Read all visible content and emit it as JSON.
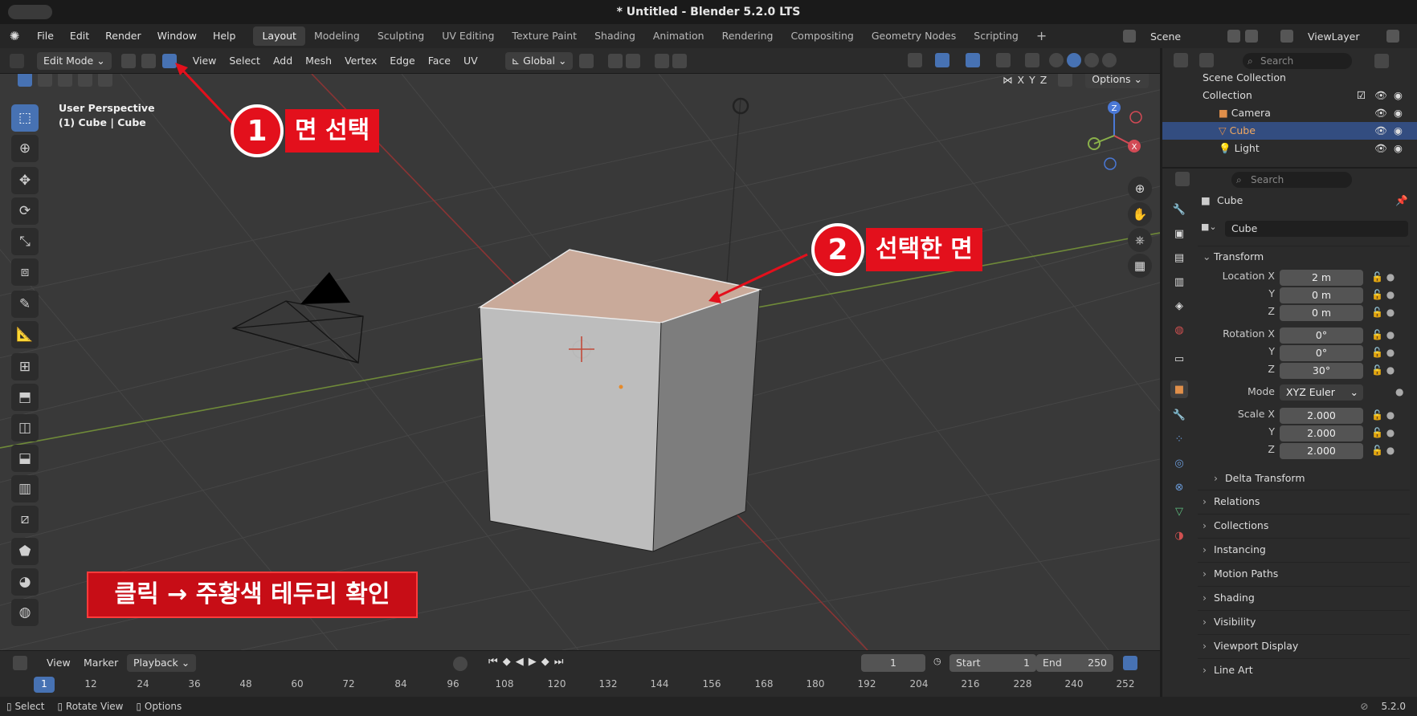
{
  "window": {
    "title": "* Untitled - Blender 5.2.0 LTS"
  },
  "menu": {
    "items": [
      "File",
      "Edit",
      "Render",
      "Window",
      "Help"
    ],
    "workspaces": [
      "Layout",
      "Modeling",
      "Sculpting",
      "UV Editing",
      "Texture Paint",
      "Shading",
      "Animation",
      "Rendering",
      "Compositing",
      "Geometry Nodes",
      "Scripting"
    ],
    "active_workspace": "Layout",
    "add_tab": "+",
    "scene": "Scene",
    "view_layer": "ViewLayer"
  },
  "viewport_header": {
    "mode": "Edit Mode",
    "menus": [
      "View",
      "Select",
      "Add",
      "Mesh",
      "Vertex",
      "Edge",
      "Face",
      "UV"
    ],
    "orientation": "Global",
    "axes": [
      "X",
      "Y",
      "Z"
    ],
    "options": "Options"
  },
  "viewport": {
    "perspective": "User Perspective",
    "object_info": "(1) Cube | Cube",
    "gizmo": {
      "z": "Z",
      "x": "X"
    }
  },
  "callouts": [
    {
      "number": "1",
      "text": "면 선택"
    },
    {
      "number": "2",
      "text": "선택한 면"
    }
  ],
  "note": "클릭 → 주황색 테두리 확인",
  "colors": {
    "accent": "#4772b3",
    "callout_red": "#e3101c",
    "selected_face": "#c9aa9a"
  },
  "outliner": {
    "search_placeholder": "Search",
    "scene_collection": "Scene Collection",
    "collection": "Collection",
    "items": [
      "Camera",
      "Cube",
      "Light"
    ],
    "selected": "Cube"
  },
  "properties": {
    "search_placeholder": "Search",
    "object_name": "Cube",
    "data_name": "Cube",
    "transform": {
      "title": "Transform",
      "location_label": "Location X",
      "rotation_label": "Rotation X",
      "scale_label": "Scale X",
      "y_label": "Y",
      "z_label": "Z",
      "location": [
        "2 m",
        "0 m",
        "0 m"
      ],
      "rotation": [
        "0°",
        "0°",
        "30°"
      ],
      "mode_label": "Mode",
      "mode": "XYZ Euler",
      "scale": [
        "2.000",
        "2.000",
        "2.000"
      ],
      "delta": "Delta Transform"
    },
    "sections": [
      "Relations",
      "Collections",
      "Instancing",
      "Motion Paths",
      "Shading",
      "Visibility",
      "Viewport Display",
      "Line Art"
    ]
  },
  "timeline": {
    "menus": [
      "View",
      "Marker",
      "Playback"
    ],
    "current_frame": "1",
    "start_label": "Start",
    "start": "1",
    "end_label": "End",
    "end": "250",
    "frames": [
      "1",
      "12",
      "24",
      "36",
      "48",
      "60",
      "72",
      "84",
      "96",
      "108",
      "120",
      "132",
      "144",
      "156",
      "168",
      "180",
      "192",
      "204",
      "216",
      "228",
      "240",
      "252"
    ]
  },
  "statusbar": {
    "select": "Select",
    "rotate": "Rotate View",
    "options": "Options",
    "version": "5.2.0"
  }
}
